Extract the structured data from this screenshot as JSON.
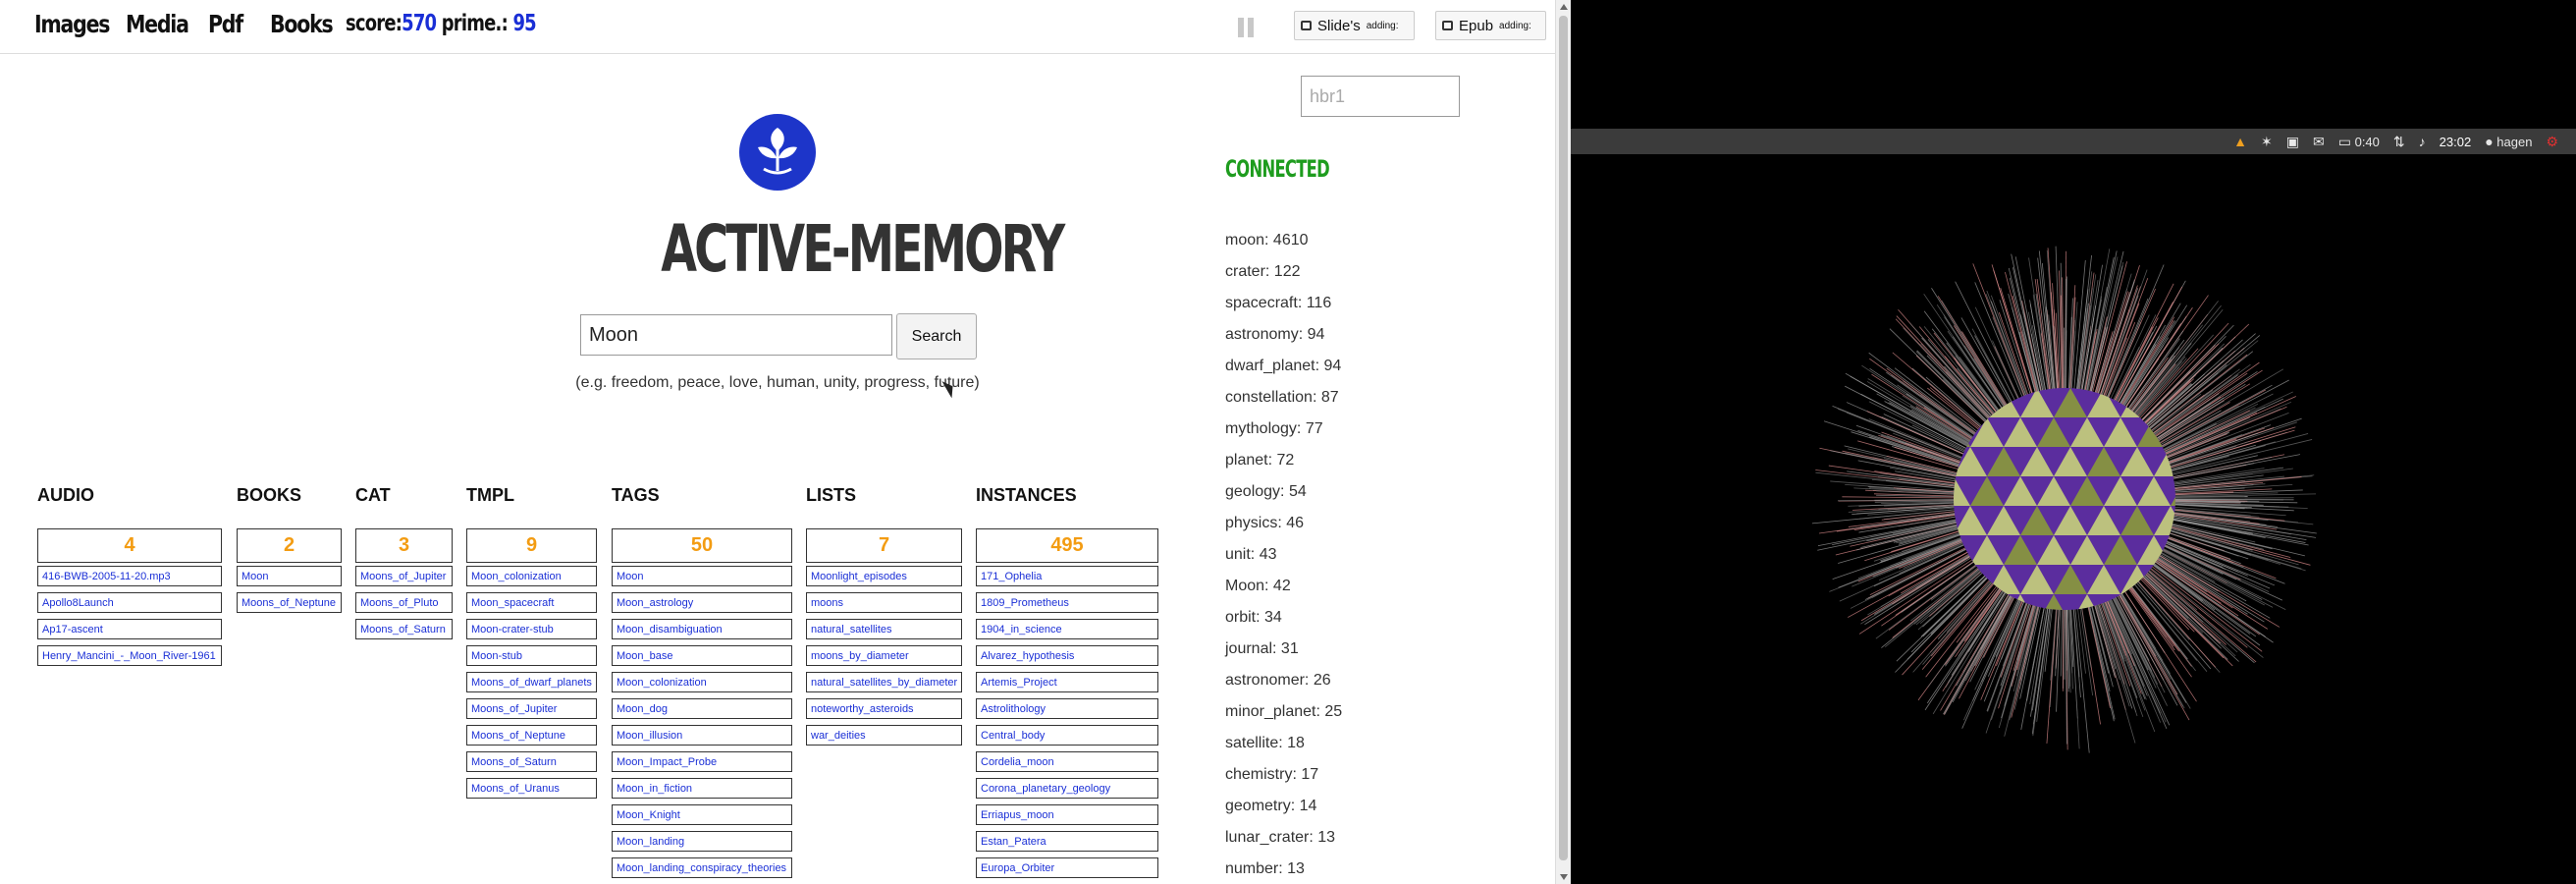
{
  "nav": {
    "images": "Images",
    "media": "Media",
    "pdf": "Pdf",
    "books": "Books"
  },
  "score": {
    "score_label": "score:",
    "score_value": "570",
    "prime_label": "prime.:",
    "prime_value": "95"
  },
  "toolbar": {
    "slides_label": "Slide's",
    "slides_adding": "adding:",
    "epub_label": "Epub",
    "epub_adding": "adding:"
  },
  "brand": "ACTIVE-MEMORY",
  "search": {
    "value": "Moon",
    "button": "Search",
    "hint": "(e.g. freedom, peace, love, human, unity, progress, future)"
  },
  "room": {
    "placeholder": "hbr1"
  },
  "status": "CONNECTED",
  "columns": [
    {
      "title": "AUDIO",
      "count": "4",
      "items": [
        "416-BWB-2005-11-20.mp3",
        "Apollo8Launch",
        "Ap17-ascent",
        "Henry_Mancini_-_Moon_River-1961"
      ]
    },
    {
      "title": "BOOKS",
      "count": "2",
      "items": [
        "Moon",
        "Moons_of_Neptune"
      ]
    },
    {
      "title": "CAT",
      "count": "3",
      "items": [
        "Moons_of_Jupiter",
        "Moons_of_Pluto",
        "Moons_of_Saturn"
      ]
    },
    {
      "title": "TMPL",
      "count": "9",
      "items": [
        "Moon_colonization",
        "Moon_spacecraft",
        "Moon-crater-stub",
        "Moon-stub",
        "Moons_of_dwarf_planets",
        "Moons_of_Jupiter",
        "Moons_of_Neptune",
        "Moons_of_Saturn",
        "Moons_of_Uranus"
      ]
    },
    {
      "title": "TAGS",
      "count": "50",
      "items": [
        "Moon",
        "Moon_astrology",
        "Moon_disambiguation",
        "Moon_base",
        "Moon_colonization",
        "Moon_dog",
        "Moon_illusion",
        "Moon_Impact_Probe",
        "Moon_in_fiction",
        "Moon_Knight",
        "Moon_landing",
        "Moon_landing_conspiracy_theories"
      ]
    },
    {
      "title": "LISTS",
      "count": "7",
      "items": [
        "Moonlight_episodes",
        "moons",
        "natural_satellites",
        "moons_by_diameter",
        "natural_satellites_by_diameter",
        "noteworthy_asteroids",
        "war_deities"
      ]
    },
    {
      "title": "INSTANCES",
      "count": "495",
      "items": [
        "171_Ophelia",
        "1809_Prometheus",
        "1904_in_science",
        "Alvarez_hypothesis",
        "Artemis_Project",
        "Astrolithology",
        "Central_body",
        "Cordelia_moon",
        "Corona_planetary_geology",
        "Erriapus_moon",
        "Estan_Patera",
        "Europa_Orbiter"
      ]
    }
  ],
  "related": [
    "moon: 4610",
    "crater: 122",
    "spacecraft: 116",
    "astronomy: 94",
    "dwarf_planet: 94",
    "constellation: 87",
    "mythology: 77",
    "planet: 72",
    "geology: 54",
    "physics: 46",
    "unit: 43",
    "Moon: 42",
    "orbit: 34",
    "journal: 31",
    "astronomer: 26",
    "minor_planet: 25",
    "satellite: 18",
    "chemistry: 17",
    "geometry: 14",
    "lunar_crater: 13",
    "number: 13"
  ],
  "panel": {
    "battery": "0:40",
    "time": "23:02",
    "user": "hagen"
  },
  "colors": {
    "accent": "#1d35c9",
    "count": "#f39c12",
    "connected": "#1e9c1e",
    "link": "#1a2fd6"
  }
}
